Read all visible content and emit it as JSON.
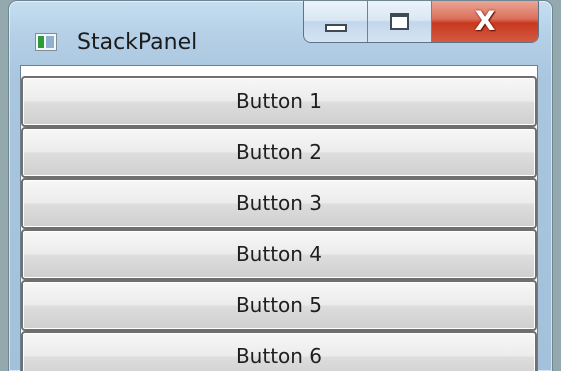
{
  "window": {
    "title": "StackPanel",
    "icon": "wpf-window-icon",
    "caption_buttons": {
      "minimize_icon": "minimize-icon",
      "maximize_icon": "maximize-icon",
      "close_icon": "close-icon",
      "close_glyph": "X"
    },
    "close_button_color": "#c8391f",
    "frame_color": "#b4cfe6"
  },
  "stack_panel": {
    "buttons": [
      {
        "label": "Button 1"
      },
      {
        "label": "Button 2"
      },
      {
        "label": "Button 3"
      },
      {
        "label": "Button 4"
      },
      {
        "label": "Button 5"
      },
      {
        "label": "Button 6"
      }
    ]
  }
}
